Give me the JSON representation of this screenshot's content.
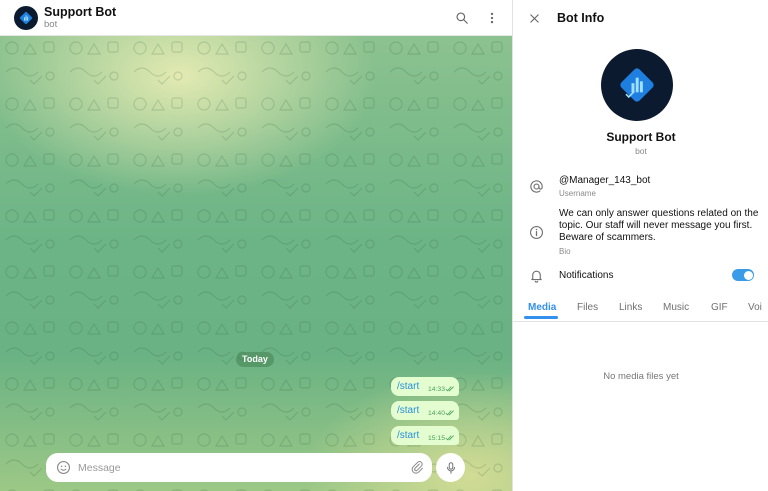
{
  "chat": {
    "title": "Support Bot",
    "subtitle": "bot",
    "date_divider": "Today",
    "messages": [
      {
        "text": "/start",
        "time": "14:33"
      },
      {
        "text": "/start",
        "time": "14:40"
      },
      {
        "text": "/start",
        "time": "15:15"
      }
    ],
    "composer_placeholder": "Message"
  },
  "info": {
    "header_title": "Bot Info",
    "name": "Support Bot",
    "kind": "bot",
    "username": "@Manager_143_bot",
    "username_label": "Username",
    "bio": "We can only answer questions related on the topic. Our staff will never message you first. Beware of scammers.",
    "bio_label": "Bio",
    "notifications_label": "Notifications",
    "notifications_on": true,
    "tabs": [
      "Media",
      "Files",
      "Links",
      "Music",
      "GIF",
      "Voi"
    ],
    "active_tab": "Media",
    "empty_text": "No media files yet"
  },
  "colors": {
    "accent": "#3390ec",
    "bubble_out": "#e3fdd0",
    "avatar_bg": "#0b1a2e"
  },
  "icons": [
    "search-icon",
    "more-vertical-icon",
    "close-icon",
    "at-icon",
    "info-icon",
    "bell-icon",
    "emoji-icon",
    "attach-icon",
    "mic-icon",
    "double-check-icon"
  ]
}
